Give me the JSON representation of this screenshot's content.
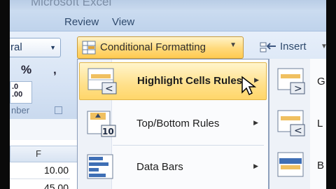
{
  "window": {
    "title": "Microsoft Excel"
  },
  "tabs": [
    {
      "label": "Review"
    },
    {
      "label": "View"
    }
  ],
  "ribbon": {
    "number_format_value": "ral",
    "percent_symbol": "%",
    "comma_symbol": ",",
    "decimal_icon_text": ".0\n.00",
    "number_group_label": "Number",
    "number_group_label_visible": "nber",
    "conditional_formatting_label": "Conditional Formatting",
    "insert_label": "Insert"
  },
  "sheet": {
    "column_header": "F",
    "cells": [
      "10.00",
      "45.00"
    ]
  },
  "menu": {
    "items": [
      {
        "label": "Highlight Cells Rules",
        "highlighted": true,
        "icon": "highlight-cells-rules-icon"
      },
      {
        "label": "Top/Bottom Rules",
        "highlighted": false,
        "icon": "top-bottom-rules-icon",
        "icon_text": "10"
      },
      {
        "label": "Data Bars",
        "highlighted": false,
        "icon": "data-bars-icon"
      }
    ]
  },
  "submenu": {
    "items": [
      {
        "label": "G",
        "icon": "greater-than-icon",
        "icon_text": ">"
      },
      {
        "label": "L",
        "icon": "less-than-icon",
        "icon_text": "<"
      },
      {
        "label": "B",
        "icon": "between-icon"
      }
    ]
  },
  "colors": {
    "accent_highlight": "#ffd97a",
    "ribbon_blue": "#dfe8f5",
    "text_blue": "#2f4a6d"
  }
}
